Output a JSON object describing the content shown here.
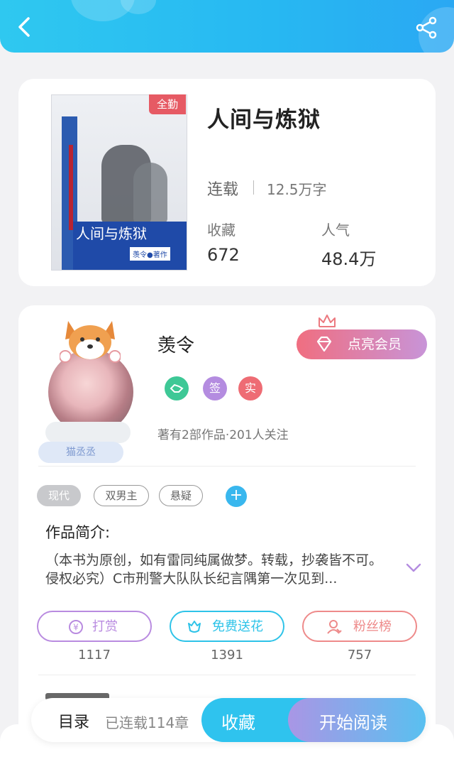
{
  "header": {
    "back_icon": "chevron-left-icon",
    "share_icon": "share-icon"
  },
  "book": {
    "title": "人间与炼狱",
    "badge": "全勤",
    "status": "连载",
    "word_count": "12.5万字",
    "stats": [
      {
        "label": "收藏",
        "value": "672"
      },
      {
        "label": "人气",
        "value": "48.4万"
      }
    ],
    "cover": {
      "title": "人间与炼狱",
      "author": "羡令●著作"
    }
  },
  "author": {
    "name": "羡令",
    "avatar_tag": "猫丞丞",
    "vip_button": "点亮会员",
    "medals": [
      {
        "name": "handshake-medal-icon",
        "text": "",
        "color": "#3ec896"
      },
      {
        "name": "signed-badge",
        "text": "签",
        "color": "#b48ce0"
      },
      {
        "name": "verified-badge",
        "text": "实",
        "color": "#ee6c74"
      }
    ],
    "stats_text": "著有2部作品·201人关注"
  },
  "tags": {
    "items": [
      {
        "label": "现代",
        "style": "filled"
      },
      {
        "label": "双男主",
        "style": "outline"
      },
      {
        "label": "悬疑",
        "style": "outline"
      }
    ],
    "add_icon": "plus-icon"
  },
  "intro": {
    "title": "作品简介:",
    "text": "（本书为原创，如有雷同纯属做梦。转载，抄袭皆不可。侵权必究）C市刑警大队队长纪言隅第一次见到..."
  },
  "actions": [
    {
      "label": "打赏",
      "count": "1117",
      "color": "#b98be0",
      "icon": "yen-coin-icon"
    },
    {
      "label": "免费送花",
      "count": "1391",
      "color": "#2ec3e8",
      "icon": "flower-icon"
    },
    {
      "label": "粉丝榜",
      "count": "757",
      "color": "#ee8a8a",
      "icon": "user-ranking-icon"
    }
  ],
  "bottom_bar": {
    "toc": "目录",
    "chapters": "已连载114章",
    "favorite": "收藏",
    "read": "开始阅读"
  },
  "colors": {
    "header": "#2ab8f2",
    "accent": "#39b7ee"
  }
}
